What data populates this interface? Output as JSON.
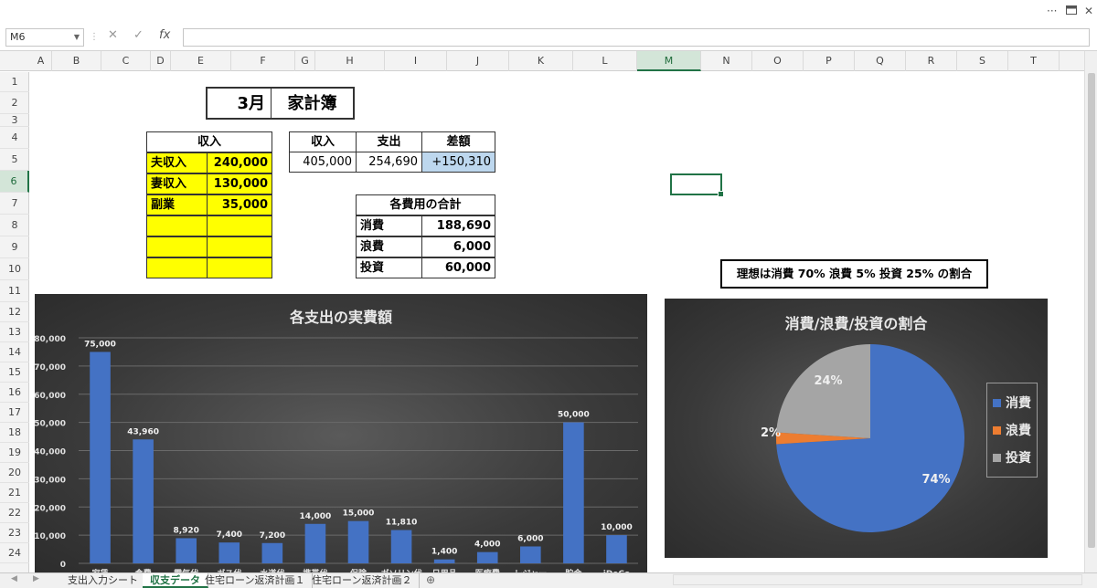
{
  "window": {
    "dots": "···"
  },
  "formula_bar": {
    "name_box": "M6",
    "cancel": "✕",
    "enter": "✓",
    "fx": "fx",
    "value": ""
  },
  "columns": [
    "A",
    "B",
    "C",
    "D",
    "E",
    "F",
    "G",
    "H",
    "I",
    "J",
    "K",
    "L",
    "M",
    "N",
    "O",
    "P",
    "Q",
    "R",
    "S",
    "T"
  ],
  "selected_column": "M",
  "rows": [
    "1",
    "2",
    "3",
    "4",
    "5",
    "6",
    "7",
    "8",
    "9",
    "10",
    "11",
    "12",
    "13",
    "14",
    "15",
    "16",
    "17",
    "18",
    "19",
    "20",
    "21",
    "22",
    "23",
    "24"
  ],
  "selected_row": "6",
  "title_block": {
    "month": "3月",
    "title": "家計簿"
  },
  "income_table": {
    "header": "収入",
    "rows": [
      {
        "label": "夫収入",
        "value": "240,000"
      },
      {
        "label": "妻収入",
        "value": "130,000"
      },
      {
        "label": "副業",
        "value": "35,000"
      },
      {
        "label": "",
        "value": ""
      },
      {
        "label": "",
        "value": ""
      },
      {
        "label": "",
        "value": ""
      }
    ]
  },
  "summary_table": {
    "headers": [
      "収入",
      "支出",
      "差額"
    ],
    "values": [
      "405,000",
      "254,690",
      "+150,310"
    ]
  },
  "cost_table": {
    "header": "各費用の合計",
    "rows": [
      {
        "label": "消費",
        "value": "188,690"
      },
      {
        "label": "浪費",
        "value": "6,000"
      },
      {
        "label": "投資",
        "value": "60,000"
      }
    ]
  },
  "ideal_note": "理想は消費 70%  浪費 5%  投資  25% の割合",
  "colors": {
    "bar": "#4472c4",
    "consume": "#4472c4",
    "waste": "#ed7d31",
    "invest": "#a5a5a5",
    "highlight": "#bdd7ee",
    "yellow": "#ffff00",
    "excel_green": "#217346"
  },
  "chart_data": [
    {
      "type": "bar",
      "title": "各支出の実費額",
      "categories": [
        "家賃",
        "食費",
        "電気代",
        "ガス代",
        "水道代",
        "携帯代",
        "保険",
        "ガソリン代",
        "日用品",
        "医療費",
        "レジャー",
        "貯金",
        "iDeCo"
      ],
      "category_labels_visible": [
        "家賃",
        "食費",
        "電気代",
        "ガス代",
        "水道代",
        "携帯代",
        "保険",
        "ガソリン代",
        "日用品",
        "医療費",
        "レジャー",
        "貯金",
        "iDeCo"
      ],
      "values": [
        75000,
        43960,
        8920,
        7400,
        7200,
        14000,
        15000,
        11810,
        1400,
        4000,
        6000,
        50000,
        10000
      ],
      "value_labels": [
        "75,000",
        "43,960",
        "8,920",
        "7,400",
        "7,200",
        "14,000",
        "15,000",
        "11,810",
        "1,400",
        "4,000",
        "6,000",
        "50,000",
        "10,000"
      ],
      "yticks": [
        "0",
        "10,000",
        "20,000",
        "30,000",
        "40,000",
        "50,000",
        "60,000",
        "70,000",
        "80,000"
      ],
      "ylim": [
        0,
        80000
      ],
      "grid": true,
      "xlabel": "",
      "ylabel": ""
    },
    {
      "type": "pie",
      "title": "消費/浪費/投資の割合",
      "slices": [
        {
          "name": "消費",
          "value": 74,
          "label": "74%"
        },
        {
          "name": "浪費",
          "value": 2,
          "label": "2%"
        },
        {
          "name": "投資",
          "value": 24,
          "label": "24%"
        }
      ],
      "legend": [
        "消費",
        "浪費",
        "投資"
      ],
      "legend_position": "right"
    }
  ],
  "sheet_tabs": [
    "支出入力シート",
    "収支データ",
    "住宅ローン返済計画１",
    "住宅ローン返済計画２"
  ],
  "active_tab": "収支データ",
  "add_sheet": "⊕"
}
